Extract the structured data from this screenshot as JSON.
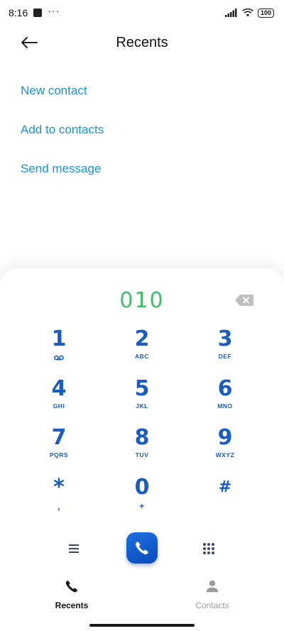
{
  "status_bar": {
    "time": "8:16",
    "more": "···",
    "battery": "100"
  },
  "header": {
    "title": "Recents"
  },
  "actions": [
    "New contact",
    "Add to contacts",
    "Send message"
  ],
  "dialer": {
    "number": "010",
    "keys": [
      {
        "digit": "1",
        "sub": ""
      },
      {
        "digit": "2",
        "sub": "ABC"
      },
      {
        "digit": "3",
        "sub": "DEF"
      },
      {
        "digit": "4",
        "sub": "GHI"
      },
      {
        "digit": "5",
        "sub": "JKL"
      },
      {
        "digit": "6",
        "sub": "MNO"
      },
      {
        "digit": "7",
        "sub": "PQRS"
      },
      {
        "digit": "8",
        "sub": "TUV"
      },
      {
        "digit": "9",
        "sub": "WXYZ"
      },
      {
        "digit": "*",
        "sub": ","
      },
      {
        "digit": "0",
        "sub": "+"
      },
      {
        "digit": "#",
        "sub": ""
      }
    ]
  },
  "nav": {
    "recents": "Recents",
    "contacts": "Contacts"
  },
  "colors": {
    "accent": "#1893d8",
    "number": "#3cc168",
    "keypad": "#1a5cc0",
    "call": "#0f57c9"
  }
}
